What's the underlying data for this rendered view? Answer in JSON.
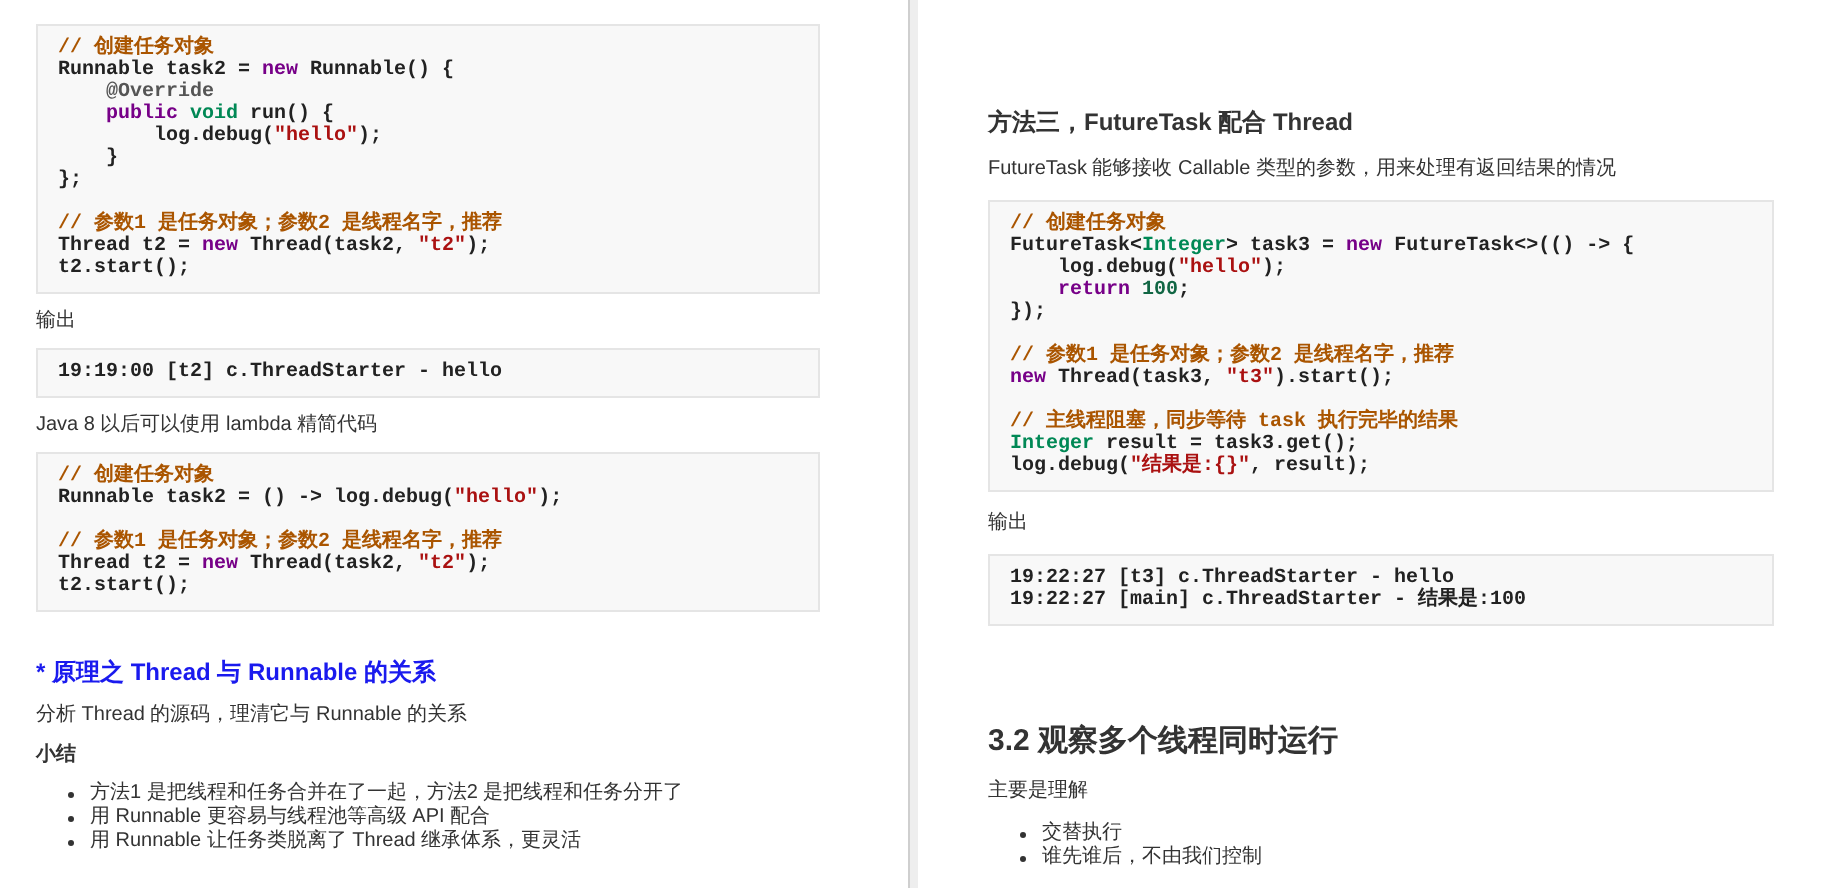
{
  "pages": [
    {
      "blocks": [
        {
          "kind": "code",
          "groups": [
            [
              [
                {
                  "kind": "comment",
                  "text": "// 创建任务对象"
                }
              ],
              [
                {
                  "kind": "plain",
                  "text": "Runnable task2 = "
                },
                {
                  "kind": "keyword",
                  "text": "new"
                },
                {
                  "kind": "plain",
                  "text": " Runnable() {"
                }
              ],
              [
                {
                  "kind": "meta",
                  "text": "    @Override"
                }
              ],
              [
                {
                  "kind": "keyword",
                  "text": "    public"
                },
                {
                  "kind": "type",
                  "text": " void"
                },
                {
                  "kind": "plain",
                  "text": " run() {"
                }
              ],
              [
                {
                  "kind": "plain",
                  "text": "        log.debug("
                },
                {
                  "kind": "string",
                  "text": "\"hello\""
                },
                {
                  "kind": "plain",
                  "text": ");"
                }
              ],
              [
                {
                  "kind": "plain",
                  "text": "    }"
                }
              ],
              [
                {
                  "kind": "plain",
                  "text": "};"
                }
              ]
            ],
            [
              [
                {
                  "kind": "comment",
                  "text": "// 参数1 是任务对象；参数2 是线程名字，推荐"
                }
              ],
              [
                {
                  "kind": "plain",
                  "text": "Thread t2 = "
                },
                {
                  "kind": "keyword",
                  "text": "new"
                },
                {
                  "kind": "plain",
                  "text": " Thread(task2, "
                },
                {
                  "kind": "string",
                  "text": "\"t2\""
                },
                {
                  "kind": "plain",
                  "text": ");"
                }
              ],
              [
                {
                  "kind": "plain",
                  "text": "t2.start();"
                }
              ]
            ]
          ]
        },
        {
          "kind": "paragraph",
          "text": "输出"
        },
        {
          "kind": "code",
          "groups": [
            [
              [
                {
                  "kind": "plain",
                  "text": "19:19:00 [t2] c.ThreadStarter - hello"
                }
              ]
            ]
          ]
        },
        {
          "kind": "paragraph",
          "text": "Java 8 以后可以使用 lambda 精简代码"
        },
        {
          "kind": "code",
          "groups": [
            [
              [
                {
                  "kind": "comment",
                  "text": "// 创建任务对象"
                }
              ],
              [
                {
                  "kind": "plain",
                  "text": "Runnable task2 = () -> log.debug("
                },
                {
                  "kind": "string",
                  "text": "\"hello\""
                },
                {
                  "kind": "plain",
                  "text": ");"
                }
              ]
            ],
            [
              [
                {
                  "kind": "comment",
                  "text": "// 参数1 是任务对象；参数2 是线程名字，推荐"
                }
              ],
              [
                {
                  "kind": "plain",
                  "text": "Thread t2 = "
                },
                {
                  "kind": "keyword",
                  "text": "new"
                },
                {
                  "kind": "plain",
                  "text": " Thread(task2, "
                },
                {
                  "kind": "string",
                  "text": "\"t2\""
                },
                {
                  "kind": "plain",
                  "text": ");"
                }
              ],
              [
                {
                  "kind": "plain",
                  "text": "t2.start();"
                }
              ]
            ]
          ]
        },
        {
          "kind": "link_heading",
          "text": "* 原理之 Thread 与 Runnable 的关系"
        },
        {
          "kind": "paragraph",
          "text": "分析 Thread 的源码，理清它与 Runnable 的关系"
        },
        {
          "kind": "strong",
          "text": "小结"
        },
        {
          "kind": "bullets",
          "items": [
            "方法1 是把线程和任务合并在了一起，方法2 是把线程和任务分开了",
            "用 Runnable 更容易与线程池等高级 API 配合",
            "用 Runnable 让任务类脱离了 Thread 继承体系，更灵活"
          ]
        }
      ]
    },
    {
      "blocks": [
        {
          "kind": "h3",
          "text": "方法三，FutureTask 配合 Thread"
        },
        {
          "kind": "paragraph",
          "text": "FutureTask 能够接收 Callable 类型的参数，用来处理有返回结果的情况"
        },
        {
          "kind": "code",
          "groups": [
            [
              [
                {
                  "kind": "comment",
                  "text": "// 创建任务对象"
                }
              ],
              [
                {
                  "kind": "plain",
                  "text": "FutureTask<"
                },
                {
                  "kind": "type",
                  "text": "Integer"
                },
                {
                  "kind": "plain",
                  "text": "> task3 = "
                },
                {
                  "kind": "keyword",
                  "text": "new"
                },
                {
                  "kind": "plain",
                  "text": " FutureTask<>(() -> {"
                }
              ],
              [
                {
                  "kind": "plain",
                  "text": "    log.debug("
                },
                {
                  "kind": "string",
                  "text": "\"hello\""
                },
                {
                  "kind": "plain",
                  "text": ");"
                }
              ],
              [
                {
                  "kind": "keyword",
                  "text": "    return"
                },
                {
                  "kind": "number",
                  "text": " 100"
                },
                {
                  "kind": "plain",
                  "text": ";"
                }
              ],
              [
                {
                  "kind": "plain",
                  "text": "});"
                }
              ]
            ],
            [
              [
                {
                  "kind": "comment",
                  "text": "// 参数1 是任务对象；参数2 是线程名字，推荐"
                }
              ],
              [
                {
                  "kind": "keyword",
                  "text": "new"
                },
                {
                  "kind": "plain",
                  "text": " Thread(task3, "
                },
                {
                  "kind": "string",
                  "text": "\"t3\""
                },
                {
                  "kind": "plain",
                  "text": ").start();"
                }
              ]
            ],
            [
              [
                {
                  "kind": "comment",
                  "text": "// 主线程阻塞，同步等待 task 执行完毕的结果"
                }
              ],
              [
                {
                  "kind": "type",
                  "text": "Integer"
                },
                {
                  "kind": "plain",
                  "text": " result = task3.get();"
                }
              ],
              [
                {
                  "kind": "plain",
                  "text": "log.debug("
                },
                {
                  "kind": "string",
                  "text": "\"结果是:{}\""
                },
                {
                  "kind": "plain",
                  "text": ", result);"
                }
              ]
            ]
          ]
        },
        {
          "kind": "paragraph",
          "text": "输出"
        },
        {
          "kind": "code",
          "groups": [
            [
              [
                {
                  "kind": "plain",
                  "text": "19:22:27 [t3] c.ThreadStarter - hello"
                }
              ],
              [
                {
                  "kind": "plain",
                  "text": "19:22:27 [main] c.ThreadStarter - 结果是:100"
                }
              ]
            ]
          ]
        },
        {
          "kind": "h2",
          "text": "3.2 观察多个线程同时运行"
        },
        {
          "kind": "paragraph",
          "text": "主要是理解"
        },
        {
          "kind": "bullets",
          "items": [
            "交替执行",
            "谁先谁后，不由我们控制"
          ]
        }
      ]
    }
  ]
}
